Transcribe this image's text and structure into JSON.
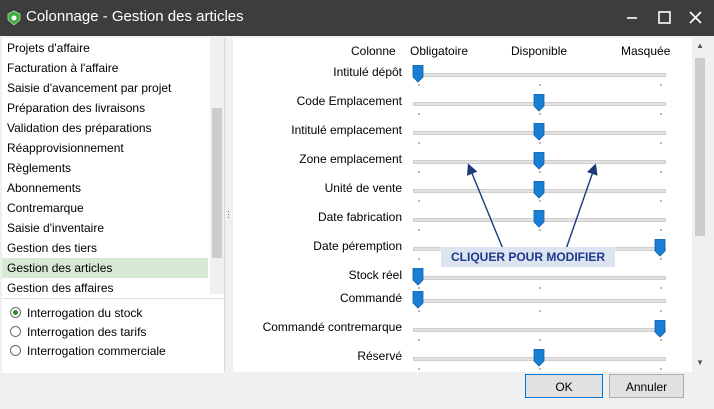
{
  "window": {
    "title": "Colonnage - Gestion des articles"
  },
  "left_list": {
    "items": [
      {
        "label": "Projets d'affaire"
      },
      {
        "label": "Facturation à l'affaire"
      },
      {
        "label": "Saisie d'avancement par projet"
      },
      {
        "label": "Préparation des livraisons"
      },
      {
        "label": "Validation des préparations"
      },
      {
        "label": "Réapprovisionnement"
      },
      {
        "label": "Règlements"
      },
      {
        "label": "Abonnements"
      },
      {
        "label": "Contremarque"
      },
      {
        "label": "Saisie d'inventaire"
      },
      {
        "label": "Gestion des tiers"
      },
      {
        "label": "Gestion des articles"
      },
      {
        "label": "Gestion des affaires"
      }
    ],
    "selected_index": 11
  },
  "radios": [
    {
      "label": "Interrogation du stock",
      "checked": true
    },
    {
      "label": "Interrogation des tarifs",
      "checked": false
    },
    {
      "label": "Interrogation commerciale",
      "checked": false
    }
  ],
  "columns_header": {
    "colonne": "Colonne",
    "obligatoire": "Obligatoire",
    "disponible": "Disponible",
    "masquee": "Masquée"
  },
  "rows": [
    {
      "label": "Intitulé dépôt",
      "state": "Obligatoire"
    },
    {
      "label": "Code Emplacement",
      "state": "Disponible"
    },
    {
      "label": "Intitulé emplacement",
      "state": "Disponible"
    },
    {
      "label": "Zone emplacement",
      "state": "Disponible"
    },
    {
      "label": "Unité de vente",
      "state": "Disponible"
    },
    {
      "label": "Date fabrication",
      "state": "Disponible"
    },
    {
      "label": "Date péremption",
      "state": "Masquée"
    },
    {
      "label": "Stock réel",
      "state": "Obligatoire"
    },
    {
      "label": "Commandé",
      "state": "Obligatoire"
    },
    {
      "label": "Commandé contremarque",
      "state": "Masquée"
    },
    {
      "label": "Réservé",
      "state": "Disponible"
    }
  ],
  "callout": {
    "text": "CLIQUER POUR MODIFIER"
  },
  "buttons": {
    "ok": "OK",
    "cancel": "Annuler"
  },
  "colors": {
    "titlebar": "#3d3d3d",
    "slider_thumb": "#1a7fd4",
    "selected_row": "#d6e9d3",
    "callout_text": "#1b3a8a"
  }
}
